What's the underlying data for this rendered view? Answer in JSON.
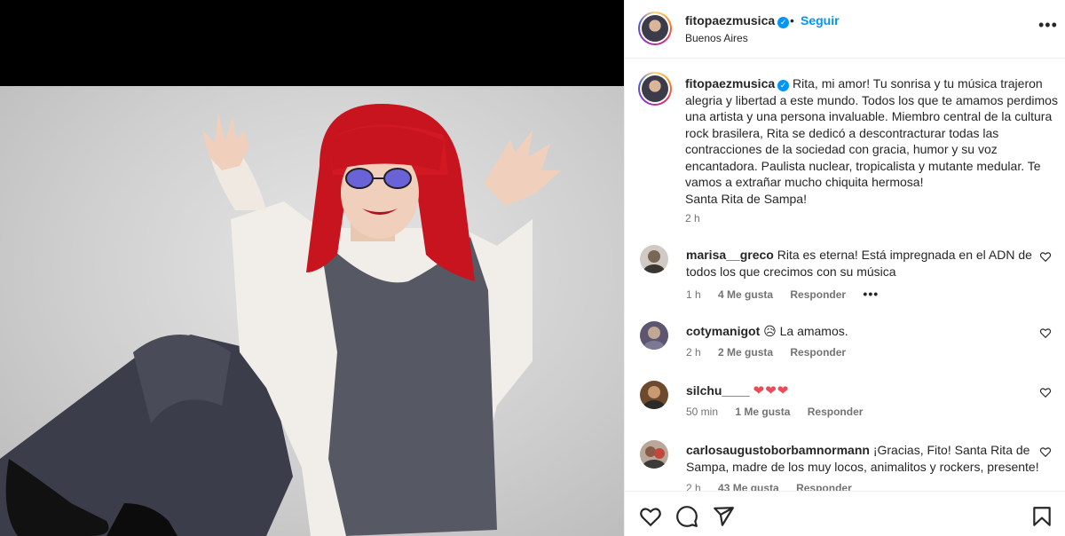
{
  "post": {
    "username": "fitopaezmusica",
    "verified_mark": "✓",
    "dot": "•",
    "follow_label": "Seguir",
    "location": "Buenos Aires",
    "more_label": "•••"
  },
  "caption": {
    "username": "fitopaezmusica",
    "text": "Rita, mi amor! Tu sonrisa y tu música trajeron alegria y libertad a este mundo. Todos los que te amamos perdimos una artista y una persona invaluable. Miembro central de la cultura rock brasilera, Rita se dedicó a descontracturar todas las contracciones de la sociedad con gracia, humor y su voz encantadora. Paulista nuclear, tropicalista y mutante medular. Te vamos a extrañar mucho chiquita hermosa!",
    "text2": "Santa Rita de Sampa!",
    "time": "2 h"
  },
  "comments": [
    {
      "username": "marisa__greco",
      "text": "Rita es eterna! Está impregnada en el ADN de todos los que crecimos con su música",
      "time": "1 h",
      "likes": "4 Me gusta",
      "reply": "Responder",
      "options": "•••"
    },
    {
      "username": "cotymanigot",
      "text": "😥 La amamos.",
      "time": "2 h",
      "likes": "2 Me gusta",
      "reply": "Responder"
    },
    {
      "username": "silchu____",
      "text": "❤❤❤",
      "time": "50 min",
      "likes": "1 Me gusta",
      "reply": "Responder"
    },
    {
      "username": "carlosaugustoborbamnormann",
      "text": "¡Gracias, Fito! Santa Rita de Sampa, madre de los muy locos, animalitos y rockers, presente!",
      "time": "2 h",
      "likes": "43 Me gusta",
      "reply": "Responder"
    }
  ],
  "icons": {
    "like": "heart-icon",
    "comment": "comment-icon",
    "share": "share-icon",
    "save": "bookmark-icon",
    "more": "more-icon",
    "comment_like": "heart-icon"
  },
  "colors": {
    "link_blue": "#0095f6",
    "secondary_text": "#737373",
    "like_red": "#ed4956",
    "border": "#efefef"
  }
}
